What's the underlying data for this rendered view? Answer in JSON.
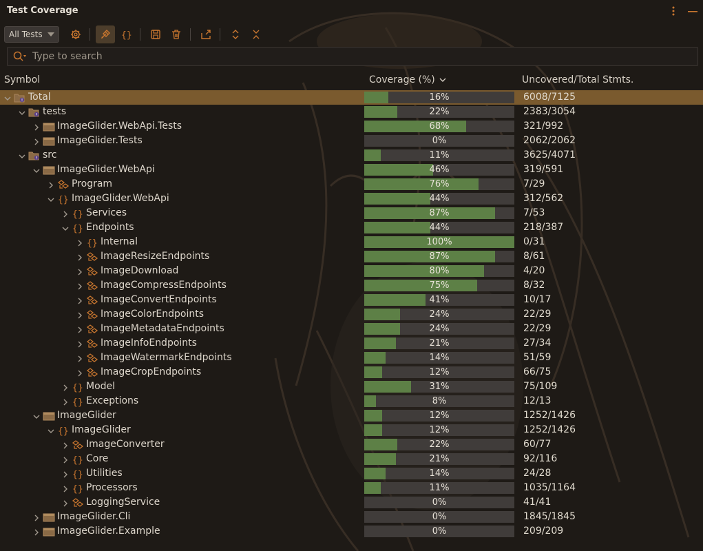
{
  "window": {
    "title": "Test Coverage"
  },
  "toolbar": {
    "scope_label": "All Tests"
  },
  "search": {
    "placeholder": "Type to search"
  },
  "columns": {
    "symbol": "Symbol",
    "coverage": "Coverage (%)",
    "uncovered": "Uncovered/Total Stmts."
  },
  "colors": {
    "bar_fill": "#5d8046",
    "bar_bg": "#403c3a",
    "accent": "#c8762f",
    "selected_row": "#7a5a2e"
  },
  "rows": [
    {
      "label": "Total",
      "depth": 0,
      "icon": "folder-test-icon",
      "expanded": true,
      "coverage": 16,
      "uncovered": "6008/7125"
    },
    {
      "label": "tests",
      "depth": 1,
      "icon": "folder-test-icon",
      "expanded": true,
      "coverage": 22,
      "uncovered": "2383/3054"
    },
    {
      "label": "ImageGlider.WebApi.Tests",
      "depth": 2,
      "icon": "module-icon",
      "expanded": false,
      "coverage": 68,
      "uncovered": "321/992"
    },
    {
      "label": "ImageGlider.Tests",
      "depth": 2,
      "icon": "module-icon",
      "expanded": false,
      "coverage": 0,
      "uncovered": "2062/2062"
    },
    {
      "label": "src",
      "depth": 1,
      "icon": "folder-test-icon",
      "expanded": true,
      "coverage": 11,
      "uncovered": "3625/4071"
    },
    {
      "label": "ImageGlider.WebApi",
      "depth": 2,
      "icon": "module-icon",
      "expanded": true,
      "coverage": 46,
      "uncovered": "319/591"
    },
    {
      "label": "Program",
      "depth": 3,
      "icon": "class-icon",
      "expanded": false,
      "coverage": 76,
      "uncovered": "7/29"
    },
    {
      "label": "ImageGlider.WebApi",
      "depth": 3,
      "icon": "namespace-icon",
      "expanded": true,
      "coverage": 44,
      "uncovered": "312/562"
    },
    {
      "label": "Services",
      "depth": 4,
      "icon": "namespace-icon",
      "expanded": false,
      "coverage": 87,
      "uncovered": "7/53"
    },
    {
      "label": "Endpoints",
      "depth": 4,
      "icon": "namespace-icon",
      "expanded": true,
      "coverage": 44,
      "uncovered": "218/387"
    },
    {
      "label": "Internal",
      "depth": 5,
      "icon": "namespace-icon",
      "expanded": false,
      "coverage": 100,
      "uncovered": "0/31"
    },
    {
      "label": "ImageResizeEndpoints",
      "depth": 5,
      "icon": "class-icon",
      "expanded": false,
      "coverage": 87,
      "uncovered": "8/61"
    },
    {
      "label": "ImageDownload",
      "depth": 5,
      "icon": "class-icon",
      "expanded": false,
      "coverage": 80,
      "uncovered": "4/20"
    },
    {
      "label": "ImageCompressEndpoints",
      "depth": 5,
      "icon": "class-icon",
      "expanded": false,
      "coverage": 75,
      "uncovered": "8/32"
    },
    {
      "label": "ImageConvertEndpoints",
      "depth": 5,
      "icon": "class-icon",
      "expanded": false,
      "coverage": 41,
      "uncovered": "10/17"
    },
    {
      "label": "ImageColorEndpoints",
      "depth": 5,
      "icon": "class-icon",
      "expanded": false,
      "coverage": 24,
      "uncovered": "22/29"
    },
    {
      "label": "ImageMetadataEndpoints",
      "depth": 5,
      "icon": "class-icon",
      "expanded": false,
      "coverage": 24,
      "uncovered": "22/29"
    },
    {
      "label": "ImageInfoEndpoints",
      "depth": 5,
      "icon": "class-icon",
      "expanded": false,
      "coverage": 21,
      "uncovered": "27/34"
    },
    {
      "label": "ImageWatermarkEndpoints",
      "depth": 5,
      "icon": "class-icon",
      "expanded": false,
      "coverage": 14,
      "uncovered": "51/59"
    },
    {
      "label": "ImageCropEndpoints",
      "depth": 5,
      "icon": "class-icon",
      "expanded": false,
      "coverage": 12,
      "uncovered": "66/75"
    },
    {
      "label": "Model",
      "depth": 4,
      "icon": "namespace-icon",
      "expanded": false,
      "coverage": 31,
      "uncovered": "75/109"
    },
    {
      "label": "Exceptions",
      "depth": 4,
      "icon": "namespace-icon",
      "expanded": false,
      "coverage": 8,
      "uncovered": "12/13"
    },
    {
      "label": "ImageGlider",
      "depth": 2,
      "icon": "module-icon",
      "expanded": true,
      "coverage": 12,
      "uncovered": "1252/1426"
    },
    {
      "label": "ImageGlider",
      "depth": 3,
      "icon": "namespace-icon",
      "expanded": true,
      "coverage": 12,
      "uncovered": "1252/1426"
    },
    {
      "label": "ImageConverter",
      "depth": 4,
      "icon": "class-icon",
      "expanded": false,
      "coverage": 22,
      "uncovered": "60/77"
    },
    {
      "label": "Core",
      "depth": 4,
      "icon": "namespace-icon",
      "expanded": false,
      "coverage": 21,
      "uncovered": "92/116"
    },
    {
      "label": "Utilities",
      "depth": 4,
      "icon": "namespace-icon",
      "expanded": false,
      "coverage": 14,
      "uncovered": "24/28"
    },
    {
      "label": "Processors",
      "depth": 4,
      "icon": "namespace-icon",
      "expanded": false,
      "coverage": 11,
      "uncovered": "1035/1164"
    },
    {
      "label": "LoggingService",
      "depth": 4,
      "icon": "class-icon",
      "expanded": false,
      "coverage": 0,
      "uncovered": "41/41"
    },
    {
      "label": "ImageGlider.Cli",
      "depth": 2,
      "icon": "module-icon",
      "expanded": false,
      "coverage": 0,
      "uncovered": "1845/1845"
    },
    {
      "label": "ImageGlider.Example",
      "depth": 2,
      "icon": "module-icon",
      "expanded": false,
      "coverage": 0,
      "uncovered": "209/209"
    }
  ]
}
